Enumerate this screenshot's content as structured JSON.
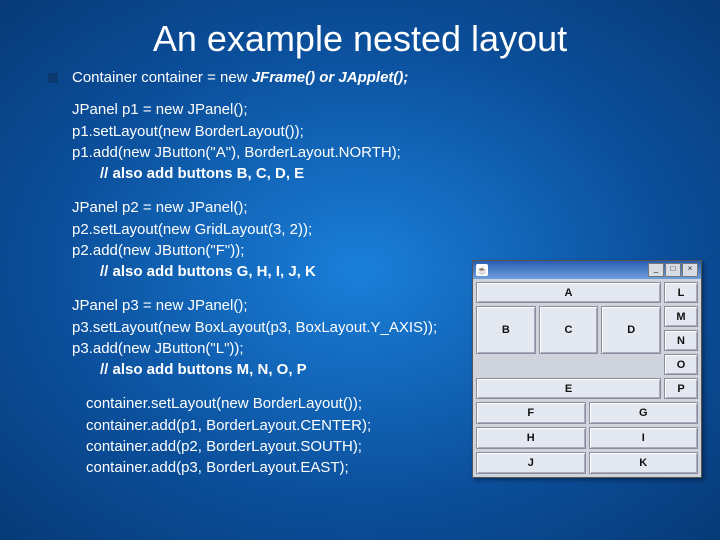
{
  "title": "An example nested layout",
  "line1_a": "Container container = new ",
  "line1_b": "JFrame()",
  "line1_c": " or ",
  "line1_d": "JApplet();",
  "b1": {
    "l1": "JPanel p1 = new JPanel();",
    "l2": "p1.setLayout(new BorderLayout());",
    "l3": "p1.add(new JButton(\"A\"), BorderLayout.NORTH);",
    "l4": "// also add buttons B, C, D, E"
  },
  "b2": {
    "l1": "JPanel p2 = new JPanel();",
    "l2": "p2.setLayout(new GridLayout(3, 2));",
    "l3": "p2.add(new JButton(\"F\"));",
    "l4": "// also add buttons G, H, I, J, K"
  },
  "b3": {
    "l1": "JPanel p3 = new JPanel();",
    "l2": "p3.setLayout(new BoxLayout(p3, BoxLayout.Y_AXIS));",
    "l3": "p3.add(new JButton(\"L\"));",
    "l4": "// also add buttons M, N, O, P"
  },
  "b4": {
    "l1": "container.setLayout(new BorderLayout());",
    "l2": "container.add(p1, BorderLayout.CENTER);",
    "l3": "container.add(p2, BorderLayout.SOUTH);",
    "l4": "container.add(p3, BorderLayout.EAST);"
  },
  "win": {
    "java_glyph": "☕",
    "min": "_",
    "max": "□",
    "close": "×",
    "A": "A",
    "B": "B",
    "C": "C",
    "D": "D",
    "E": "E",
    "L": "L",
    "M": "M",
    "N": "N",
    "O": "O",
    "P": "P",
    "F": "F",
    "G": "G",
    "H": "H",
    "I": "I",
    "J": "J",
    "K": "K"
  }
}
